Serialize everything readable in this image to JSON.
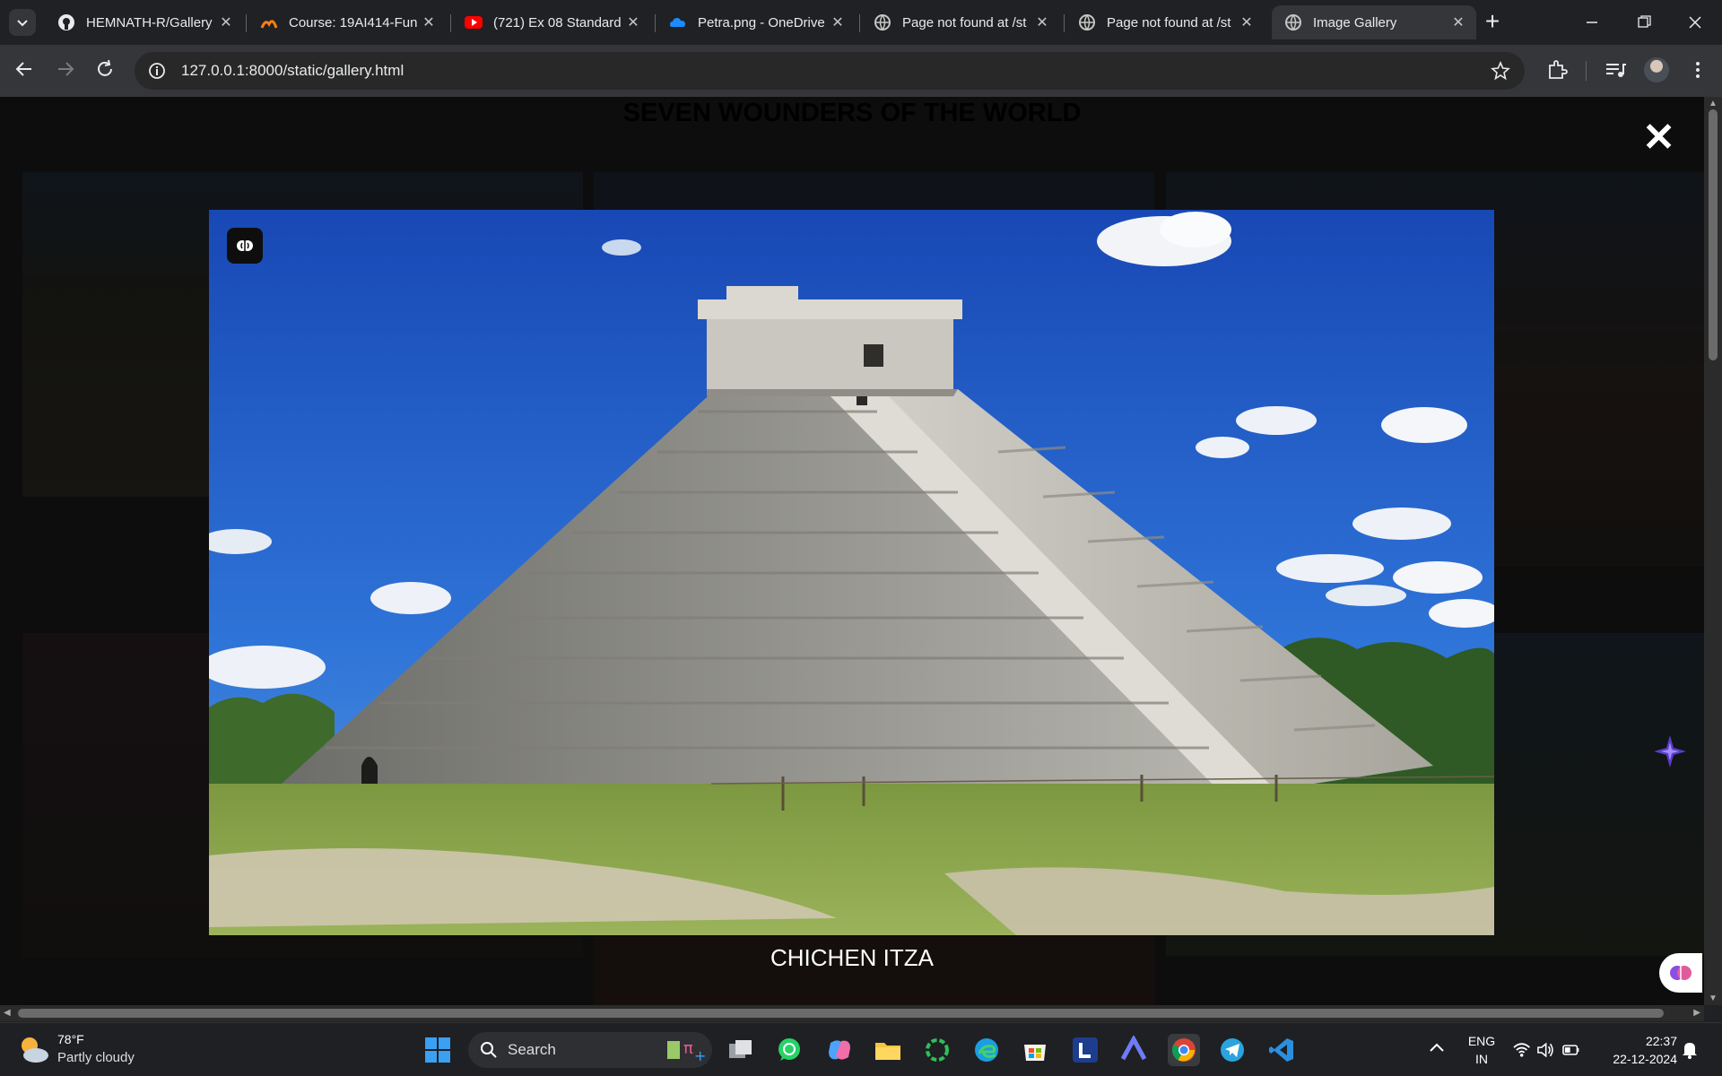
{
  "browser": {
    "tabs": [
      {
        "title": "HEMNATH-R/Gallery",
        "icon": "github-icon",
        "active": false
      },
      {
        "title": "Course: 19AI414-Fun",
        "icon": "moodle-icon",
        "active": false
      },
      {
        "title": "(721) Ex 08 Standard",
        "icon": "youtube-icon",
        "active": false
      },
      {
        "title": "Petra.png - OneDrive",
        "icon": "onedrive-icon",
        "active": false
      },
      {
        "title": "Page not found at /st",
        "icon": "globe-icon",
        "active": false
      },
      {
        "title": "Page not found at /st",
        "icon": "globe-icon",
        "active": false
      },
      {
        "title": "Image Gallery",
        "icon": "globe-icon",
        "active": true
      }
    ],
    "new_tab_label": "+",
    "url": "127.0.0.1:8000/static/gallery.html"
  },
  "page": {
    "title": "SEVEN WOUNDERS OF THE WORLD",
    "modal": {
      "close_glyph": "✕",
      "caption": "CHICHEN ITZA"
    }
  },
  "taskbar": {
    "weather_temp": "78°F",
    "weather_desc": "Partly cloudy",
    "search_label": "Search",
    "lang_top": "ENG",
    "lang_bottom": "IN",
    "time": "22:37",
    "date": "22-12-2024"
  },
  "colors": {
    "accent": "#1a73e8",
    "sky": "#1f5fd0",
    "stone": "#bdbbb2",
    "grass": "#8ea84a"
  }
}
